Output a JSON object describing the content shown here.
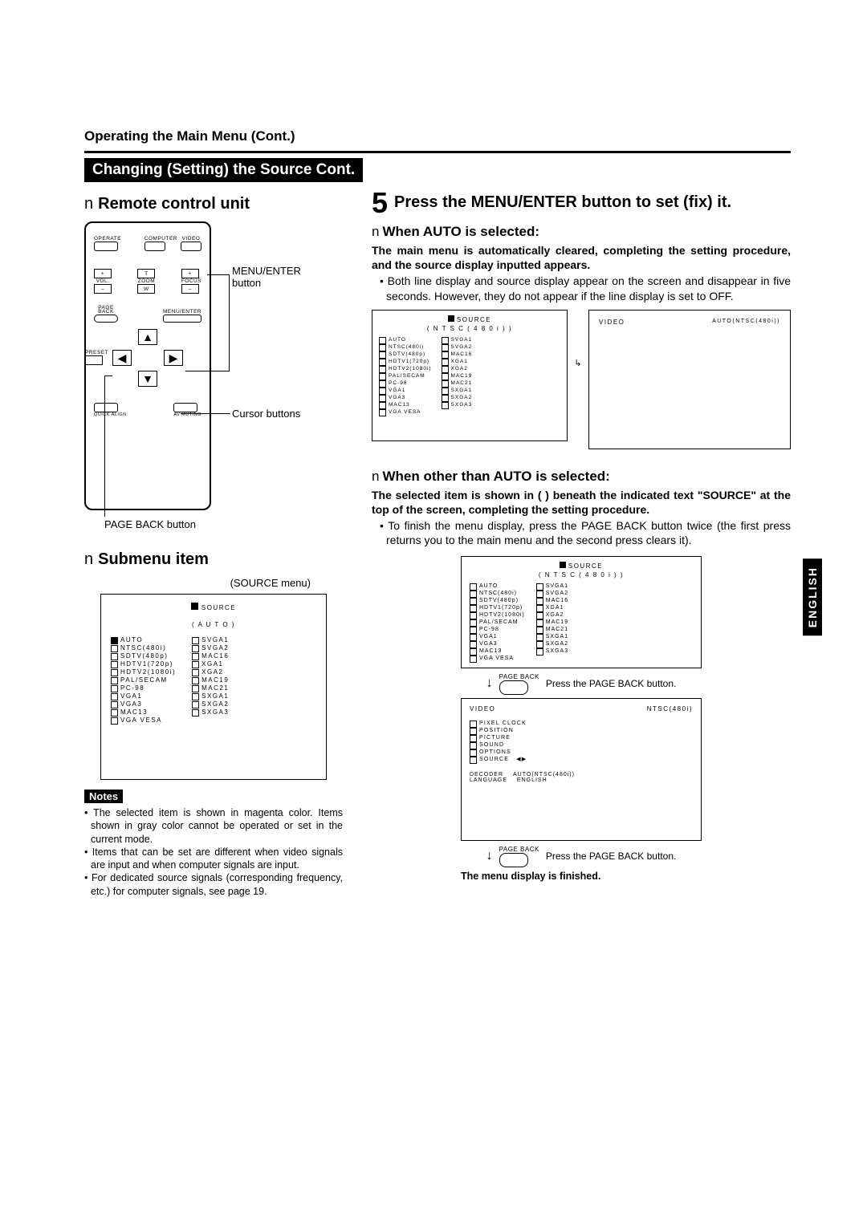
{
  "language_tab": "ENGLISH",
  "section_heading": "Operating the Main Menu (Cont.)",
  "black_bar": "Changing (Setting) the Source Cont.",
  "left": {
    "remote_heading": "Remote control unit",
    "submenu_heading": "Submenu item",
    "remote_labels": {
      "menu_enter": "MENU/ENTER button",
      "cursor": "Cursor buttons",
      "page_back": "PAGE BACK button"
    },
    "remote_small": {
      "operate": "OPERATE",
      "computer": "COMPUTER",
      "video": "VIDEO",
      "vol": "VOL.",
      "zoom": "ZOOM",
      "focus": "FOCUS",
      "page": "PAGE",
      "back": "BACK",
      "menu_enter": "MENU/ENTER",
      "preset": "PRESET",
      "quick_align": "QUICK ALIGN.",
      "av_muting": "AV MUTING",
      "t": "T",
      "w": "W",
      "plus": "+",
      "minus": "–"
    },
    "source_menu_caption": "(SOURCE menu)",
    "source_menu": {
      "title": "SOURCE",
      "subtitle": "( A U T O )",
      "col1": [
        "AUTO",
        "NTSC(480i)",
        "SDTV(480p)",
        "HDTV1(720p)",
        "HDTV2(1080i)",
        "PAL/SECAM",
        "PC-98",
        "VGA1",
        "VGA3",
        "MAC13",
        "VGA VESA"
      ],
      "col2": [
        "SVGA1",
        "SVGA2",
        "MAC16",
        "XGA1",
        "XGA2",
        "MAC19",
        "MAC21",
        "SXGA1",
        "SXGA2",
        "SXGA3"
      ]
    },
    "notes_label": "Notes",
    "notes": [
      "• The selected item is shown in magenta color. Items shown in gray color cannot be operated or set in the current mode.",
      "• Items that can be set are different when video signals are input and when computer signals are input.",
      "• For dedicated source signals (corresponding frequency, etc.) for computer signals, see page 19."
    ]
  },
  "right": {
    "step_num": "5",
    "step_title": "Press the MENU/ENTER button to set (fix) it.",
    "auto": {
      "heading": "When AUTO is selected:",
      "bold": "The main menu is automatically cleared, completing the setting procedure, and the source display inputted appears.",
      "bullet": "• Both line display and source display appear on the screen and disappear in five seconds. However, they do not appear if the line display is set to OFF.",
      "menu_subtitle": "( N T S C ( 4 8 0 i ) )",
      "result_left": "VIDEO",
      "result_right": "AUTO(NTSC(480i))"
    },
    "other": {
      "heading": "When other than AUTO is selected:",
      "bold": "The selected item is shown in (    ) beneath the indicated text \"SOURCE\" at the top of the screen, completing the setting procedure.",
      "bullet": "• To finish the menu display, press the PAGE BACK button twice (the first press returns you to the main menu and the second press clears it).",
      "press_page_back": "Press the PAGE BACK button.",
      "main_menu": {
        "header_left": "VIDEO",
        "header_right": "NTSC(480i)",
        "items": [
          "PIXEL CLOCK",
          "POSITION",
          "PICTURE",
          "SOUND",
          "OPTIONS",
          "SOURCE"
        ],
        "decoder_l": "DECODER",
        "decoder_r": "AUTO(NTSC(480i))",
        "language_l": "LANGUAGE",
        "language_r": "ENGLISH"
      },
      "finished": "The menu display is finished."
    },
    "source_menu": {
      "title": "SOURCE",
      "col1": [
        "AUTO",
        "NTSC(480i)",
        "SDTV(480p)",
        "HDTV1(720p)",
        "HDTV2(1080i)",
        "PAL/SECAM",
        "PC-98",
        "VGA1",
        "VGA3",
        "MAC13",
        "VGA VESA"
      ],
      "col2": [
        "SVGA1",
        "SVGA2",
        "MAC16",
        "XGA1",
        "XGA2",
        "MAC19",
        "MAC21",
        "SXGA1",
        "SXGA2",
        "SXGA3"
      ]
    },
    "page_back_label": "PAGE BACK"
  }
}
